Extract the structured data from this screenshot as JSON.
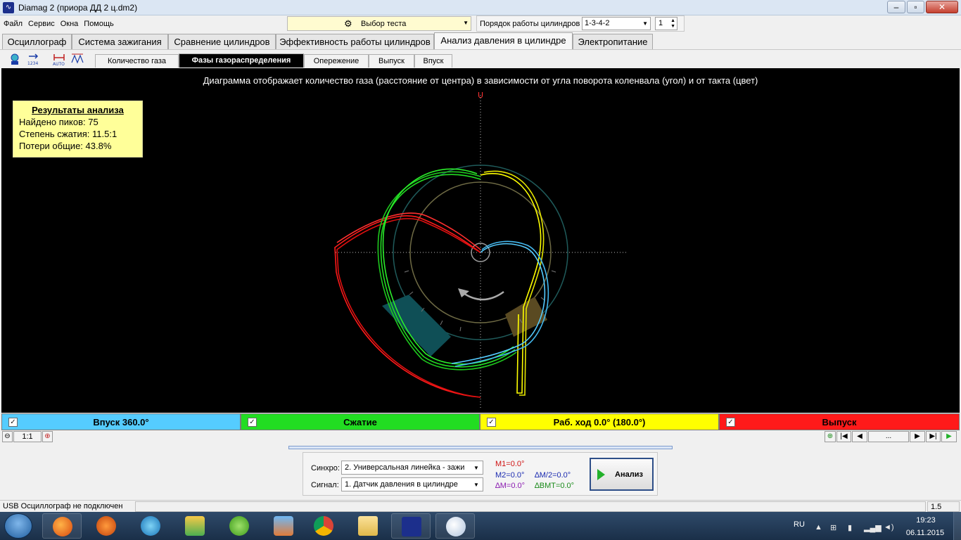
{
  "window": {
    "title": "Diamag 2 (приора  ДД 2 ц.dm2)"
  },
  "menu": [
    "Файл",
    "Сервис",
    "Окна",
    "Помощь"
  ],
  "toolbar": {
    "test_select_label": "Выбор теста",
    "cyl_order_label": "Порядок работы цилиндров",
    "cyl_order_value": "1-3-4-2",
    "cyl_number": "1"
  },
  "main_tabs": [
    "Осциллограф",
    "Система зажигания",
    "Сравнение цилиндров",
    "Эффективность работы цилиндров",
    "Анализ давления в цилиндре",
    "Электропитание"
  ],
  "main_tab_active": "Анализ давления в цилиндре",
  "sub_tabs": [
    "Количество газа",
    "Фазы газораспределения",
    "Опережение",
    "Выпуск",
    "Впуск"
  ],
  "sub_tab_active": "Фазы газораспределения",
  "chart": {
    "caption": "Диаграмма отображает количество газа (расстояние от центра) в зависимости от угла поворота коленвала (угол) и от такта (цвет)",
    "results_title": "Результаты анализа",
    "results": [
      "Найдено пиков: 75",
      "Степень сжатия: 11.5:1",
      "Потери общие: 43.8%"
    ]
  },
  "chart_data": {
    "type": "scatter",
    "title": "Диаграмма отображает количество газа (расстояние от центра) в зависимости от угла поворота коленвала (угол) и от такта (цвет)",
    "series": [
      {
        "name": "Впуск 360.0°",
        "color": "#55ccff"
      },
      {
        "name": "Сжатие",
        "color": "#22dd22"
      },
      {
        "name": "Раб. ход 0.0° (180.0°)",
        "color": "#ffff00"
      },
      {
        "name": "Выпуск",
        "color": "#ff1a1a"
      }
    ],
    "grid": true
  },
  "legend": [
    {
      "label": "Впуск 360.0°",
      "color": "#55ccff",
      "checked": true
    },
    {
      "label": "Сжатие",
      "color": "#22dd22",
      "checked": true
    },
    {
      "label": "Раб. ход 0.0° (180.0°)",
      "color": "#ffff00",
      "checked": true
    },
    {
      "label": "Выпуск",
      "color": "#ff1a1a",
      "checked": true
    }
  ],
  "zoom": {
    "value": "1:1"
  },
  "nav": {
    "ellipsis": "..."
  },
  "controls": {
    "sync_label": "Синхро:",
    "sync_value": "2. Универсальная линейка - зажи",
    "signal_label": "Сигнал:",
    "signal_value": "1. Датчик давления в цилиндре",
    "m1": "M1=0.0°",
    "m2": "M2=0.0°",
    "dm2": "∆M/2=0.0°",
    "dm": "∆M=0.0°",
    "dbmt": "∆BMT=0.0°",
    "analyze_label": "Анализ"
  },
  "status": {
    "left": "USB Осциллограф не подключен",
    "right": "1.5"
  },
  "taskbar": {
    "lang": "RU",
    "time": "19:23",
    "date": "06.11.2015"
  }
}
